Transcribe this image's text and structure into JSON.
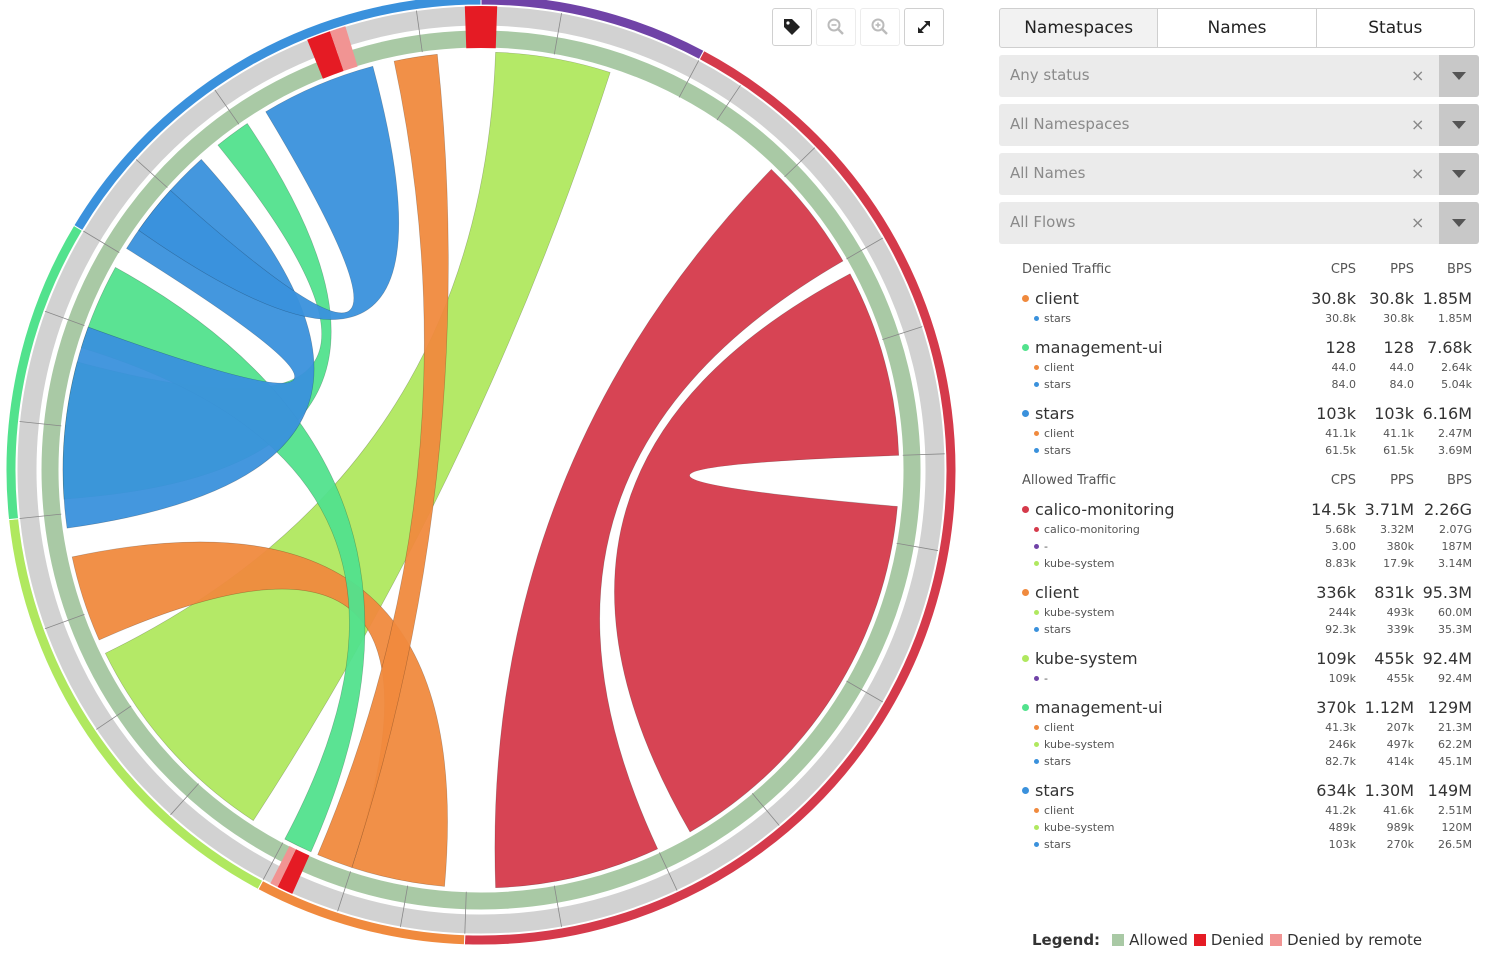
{
  "colors": {
    "calico_monitoring": "#d53a4b",
    "dash": "#7043a7",
    "stars": "#3a91dc",
    "management_ui": "#52e28d",
    "kube_system": "#b0e85f",
    "client": "#f08a3e",
    "allowed": "#a9c9a5",
    "denied": "#e51b24",
    "denied_by_remote": "#f19493",
    "ring": "#d2d2d2"
  },
  "toolbar": {
    "labels_icon": "tag-icon",
    "zoom_out_icon": "zoom-out-icon",
    "zoom_in_icon": "zoom-in-icon",
    "expand_icon": "expand-icon"
  },
  "tabs": [
    {
      "label": "Namespaces",
      "active": true
    },
    {
      "label": "Names",
      "active": false
    },
    {
      "label": "Status",
      "active": false
    }
  ],
  "filters": [
    {
      "placeholder": "Any status",
      "clear": "×"
    },
    {
      "placeholder": "All Namespaces",
      "clear": "×"
    },
    {
      "placeholder": "All Names",
      "clear": "×"
    },
    {
      "placeholder": "All Flows",
      "clear": "×"
    }
  ],
  "denied": {
    "title": "Denied Traffic",
    "cols": [
      "CPS",
      "PPS",
      "BPS"
    ],
    "groups": [
      {
        "name": "client",
        "color": "#f08a3e",
        "cps": "30.8k",
        "pps": "30.8k",
        "bps": "1.85M",
        "subs": [
          {
            "name": "stars",
            "color": "#3a91dc",
            "cps": "30.8k",
            "pps": "30.8k",
            "bps": "1.85M"
          }
        ]
      },
      {
        "name": "management-ui",
        "color": "#52e28d",
        "cps": "128",
        "pps": "128",
        "bps": "7.68k",
        "subs": [
          {
            "name": "client",
            "color": "#f08a3e",
            "cps": "44.0",
            "pps": "44.0",
            "bps": "2.64k"
          },
          {
            "name": "stars",
            "color": "#3a91dc",
            "cps": "84.0",
            "pps": "84.0",
            "bps": "5.04k"
          }
        ]
      },
      {
        "name": "stars",
        "color": "#3a91dc",
        "cps": "103k",
        "pps": "103k",
        "bps": "6.16M",
        "subs": [
          {
            "name": "client",
            "color": "#f08a3e",
            "cps": "41.1k",
            "pps": "41.1k",
            "bps": "2.47M"
          },
          {
            "name": "stars",
            "color": "#3a91dc",
            "cps": "61.5k",
            "pps": "61.5k",
            "bps": "3.69M"
          }
        ]
      }
    ]
  },
  "allowed": {
    "title": "Allowed Traffic",
    "cols": [
      "CPS",
      "PPS",
      "BPS"
    ],
    "groups": [
      {
        "name": "calico-monitoring",
        "color": "#d53a4b",
        "cps": "14.5k",
        "pps": "3.71M",
        "bps": "2.26G",
        "subs": [
          {
            "name": "calico-monitoring",
            "color": "#d53a4b",
            "cps": "5.68k",
            "pps": "3.32M",
            "bps": "2.07G"
          },
          {
            "name": "-",
            "color": "#7043a7",
            "cps": "3.00",
            "pps": "380k",
            "bps": "187M"
          },
          {
            "name": "kube-system",
            "color": "#b0e85f",
            "cps": "8.83k",
            "pps": "17.9k",
            "bps": "3.14M"
          }
        ]
      },
      {
        "name": "client",
        "color": "#f08a3e",
        "cps": "336k",
        "pps": "831k",
        "bps": "95.3M",
        "subs": [
          {
            "name": "kube-system",
            "color": "#b0e85f",
            "cps": "244k",
            "pps": "493k",
            "bps": "60.0M"
          },
          {
            "name": "stars",
            "color": "#3a91dc",
            "cps": "92.3k",
            "pps": "339k",
            "bps": "35.3M"
          }
        ]
      },
      {
        "name": "kube-system",
        "color": "#b0e85f",
        "cps": "109k",
        "pps": "455k",
        "bps": "92.4M",
        "subs": [
          {
            "name": "-",
            "color": "#7043a7",
            "cps": "109k",
            "pps": "455k",
            "bps": "92.4M"
          }
        ]
      },
      {
        "name": "management-ui",
        "color": "#52e28d",
        "cps": "370k",
        "pps": "1.12M",
        "bps": "129M",
        "subs": [
          {
            "name": "client",
            "color": "#f08a3e",
            "cps": "41.3k",
            "pps": "207k",
            "bps": "21.3M"
          },
          {
            "name": "kube-system",
            "color": "#b0e85f",
            "cps": "246k",
            "pps": "497k",
            "bps": "62.2M"
          },
          {
            "name": "stars",
            "color": "#3a91dc",
            "cps": "82.7k",
            "pps": "414k",
            "bps": "45.1M"
          }
        ]
      },
      {
        "name": "stars",
        "color": "#3a91dc",
        "cps": "634k",
        "pps": "1.30M",
        "bps": "149M",
        "subs": [
          {
            "name": "client",
            "color": "#f08a3e",
            "cps": "41.2k",
            "pps": "41.6k",
            "bps": "2.51M"
          },
          {
            "name": "kube-system",
            "color": "#b0e85f",
            "cps": "489k",
            "pps": "989k",
            "bps": "120M"
          },
          {
            "name": "stars",
            "color": "#3a91dc",
            "cps": "103k",
            "pps": "270k",
            "bps": "26.5M"
          }
        ]
      }
    ]
  },
  "legend": {
    "title": "Legend:",
    "items": [
      {
        "label": "Allowed",
        "color": "#a9c9a5"
      },
      {
        "label": "Denied",
        "color": "#e51b24"
      },
      {
        "label": "Denied by remote",
        "color": "#f19493"
      }
    ]
  },
  "chord": {
    "arcs": [
      {
        "ns": "-",
        "color": "#7043a7",
        "from": 0,
        "to": 28
      },
      {
        "ns": "calico-monitoring",
        "color": "#d53a4b",
        "from": 28,
        "to": 182
      },
      {
        "ns": "client",
        "color": "#f08a3e",
        "from": 182,
        "to": 208
      },
      {
        "ns": "kube-system",
        "color": "#b0e85f",
        "from": 208,
        "to": 264
      },
      {
        "ns": "management-ui",
        "color": "#52e28d",
        "from": 264,
        "to": 301
      },
      {
        "ns": "stars",
        "color": "#3a91dc",
        "from": 301,
        "to": 360
      }
    ],
    "ribbons": [
      {
        "from": "calico-monitoring",
        "to": "calico-monitoring",
        "color": "#d53a4b",
        "a": [
          155,
          178
        ],
        "b": [
          44,
          60
        ]
      },
      {
        "from": "calico-monitoring",
        "to": "calico-monitoring",
        "color": "#d53a4b",
        "a": [
          62,
          88
        ],
        "b": [
          95,
          150
        ]
      },
      {
        "from": "kube-system",
        "to": "-",
        "color": "#b0e85f",
        "a": [
          213,
          244
        ],
        "b": [
          2,
          18
        ]
      },
      {
        "from": "client",
        "to": "kube-system",
        "color": "#f08a3e",
        "a": [
          185,
          198
        ],
        "b": [
          246,
          258
        ]
      },
      {
        "from": "client",
        "to": "stars",
        "color": "#f08a3e",
        "a": [
          198,
          203
        ],
        "b": [
          348,
          354
        ]
      },
      {
        "from": "management-ui",
        "to": "stars",
        "color": "#52e28d",
        "a": [
          266,
          285
        ],
        "b": [
          321,
          326
        ]
      },
      {
        "from": "management-ui",
        "to": "kube-system",
        "color": "#52e28d",
        "a": [
          287,
          299
        ],
        "b": [
          204,
          208
        ]
      },
      {
        "from": "stars",
        "to": "kube-system",
        "color": "#3a91dc",
        "a": [
          302,
          318
        ],
        "b": [
          262,
          290
        ]
      },
      {
        "from": "stars",
        "to": "stars",
        "color": "#3a91dc",
        "a": [
          329,
          345
        ],
        "b": [
          305,
          312
        ]
      }
    ]
  }
}
